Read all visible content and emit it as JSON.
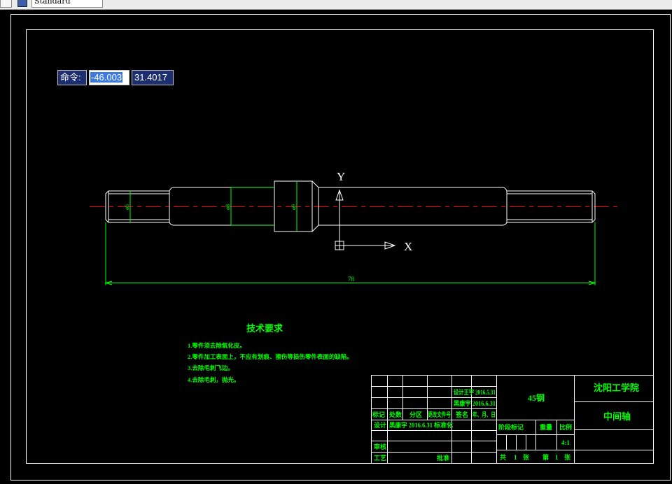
{
  "toolbar": {
    "style_combo_value": "Standard",
    "layers_icon": "layers-icon"
  },
  "command_input": {
    "label": "命令:",
    "x_value": "-46.003",
    "y_value": "31.4017"
  },
  "ucs": {
    "x_label": "X",
    "y_label": "Y"
  },
  "dimensions": {
    "overall_length": "78",
    "dia_left": "ø5",
    "dia_mid": "ø8",
    "dia_collar": "ø9"
  },
  "tech_requirements": {
    "title": "技术要求",
    "items": [
      "1.零件须去除氧化皮。",
      "2.零件加工表面上，不应有划痕、擦伤等损伤零件表面的缺陷。",
      "3.去除毛刺飞边。",
      "4.去除毛刺，抛光。"
    ]
  },
  "title_block": {
    "material": "45钢",
    "school": "沈阳工学院",
    "part_name": "中间轴",
    "dwg_a": "设计王宇 2016.5.31",
    "dwg_b": "黑康宇 2016.6.31",
    "col_mark": "标记",
    "col_count": "处数",
    "col_zone": "分区",
    "col_doc": "更改文件号",
    "col_sign": "签名",
    "col_date": "年、月、日",
    "row_design": "设计",
    "design_person": "黑康宇 2016.6.31",
    "row_standard": "标准化",
    "row_review": "审核",
    "row_process": "工艺",
    "row_approve": "批准",
    "stage_mark": "阶段标记",
    "weight": "重量",
    "scale": "比例",
    "scale_value": "4:1",
    "total_label": "共",
    "total_num": "1",
    "sheet_unit": "张",
    "page_label": "第",
    "page_num": "1"
  },
  "colors": {
    "background": "#000000",
    "geometry": "#ffffff",
    "dimension": "#00ff00",
    "centerline": "#ff0000",
    "command_bg": "#1d2f6e"
  }
}
